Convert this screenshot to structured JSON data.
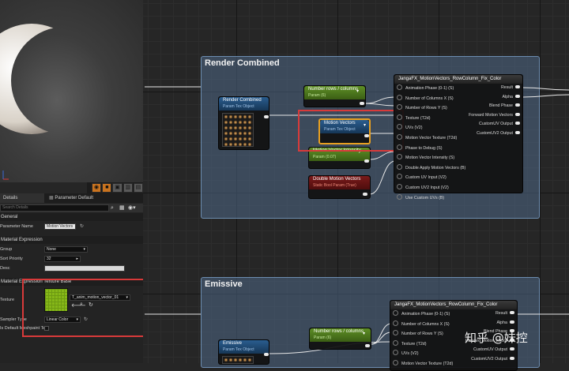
{
  "details_panel": {
    "tab_details": "Details",
    "tab_param_defaults": "Parameter Default",
    "search_placeholder": "Search Details",
    "section_general": "General",
    "param_name_label": "Parameter Name",
    "param_name_value": "Motion Vectors",
    "section_material_expression": "Material Expression",
    "group_label": "Group",
    "group_value": "None",
    "sort_priority_label": "Sort Priority",
    "sort_priority_value": "32",
    "desc_label": "Desc",
    "desc_value": "",
    "section_texture_base": "Material Expression Texture Base",
    "texture_label": "Texture",
    "texture_value": "T_anim_motion_vector_01",
    "sampler_type_label": "Sampler Type",
    "sampler_type_value": "Linear Color",
    "default_meshpaint_label": "Is Default Meshpaint Tex"
  },
  "graph": {
    "comment_render_combined": "Render Combined",
    "comment_emissive": "Emissive",
    "node_render_combined": {
      "title": "Render Combined",
      "subtitle": "Param Tex Object"
    },
    "node_number_rows_columns": {
      "title": "Number rows / columns",
      "subtitle": "Param (6)"
    },
    "node_motion_vectors": {
      "title": "Motion Vectors",
      "subtitle": "Param Tex Object"
    },
    "node_motion_vector_intensity": {
      "title": "Motion Vector Intensity",
      "subtitle": "Param (0.07)"
    },
    "node_double_motion_vectors": {
      "title": "Double Motion Vectors",
      "subtitle": "Static Bool Param (True)"
    },
    "node_emissive": {
      "title": "Emissive",
      "subtitle": "Param Tex Object"
    },
    "node_number_rows_columns_2": {
      "title": "Number rows / columns",
      "subtitle": "Param (6)"
    },
    "function_top": {
      "title": "JangaFX_MotionVectors_RowColumn_Fix_Color",
      "inputs": [
        "Animation Phase (0-1) (S)",
        "Number of Columns X (S)",
        "Number of Rows Y (S)",
        "Texture (T2d)",
        "UVs (V2)",
        "Motion Vector Texture (T2d)",
        "Phase to Debug (S)",
        "Motion Vector Intensity (S)",
        "Double Apply Motion Vectors (B)",
        "Custom UV Input (V2)",
        "Custom UV2 Input (V2)",
        "Use Custom UVs (B)"
      ],
      "outputs": [
        "Result",
        "Alpha",
        "Blend Phase",
        "Forward Motion Vectors",
        "CustomUV Output",
        "CustomUV2 Output"
      ]
    },
    "function_bottom": {
      "title": "JangaFX_MotionVectors_RowColumn_Fix_Color",
      "inputs": [
        "Animation Phase (0-1) (S)",
        "Number of Columns X (S)",
        "Number of Rows Y (S)",
        "Texture (T2d)",
        "UVs (V2)",
        "Motion Vector Texture (T2d)"
      ],
      "outputs": [
        "Result",
        "Alpha",
        "Blend Phase",
        "Forward Motion Vector",
        "CustomUV Output",
        "CustomUV2 Output"
      ]
    }
  },
  "watermark": "知乎 @妹控",
  "colors": {
    "comment_fill": "#4e6886",
    "comment_border": "#6d8db0",
    "param_header_blue": "#1f4a78",
    "param_header_green": "#4d7a1c",
    "param_header_red": "#6d1616",
    "highlight_red": "#d83a3a",
    "selection_orange": "#e8a020"
  }
}
